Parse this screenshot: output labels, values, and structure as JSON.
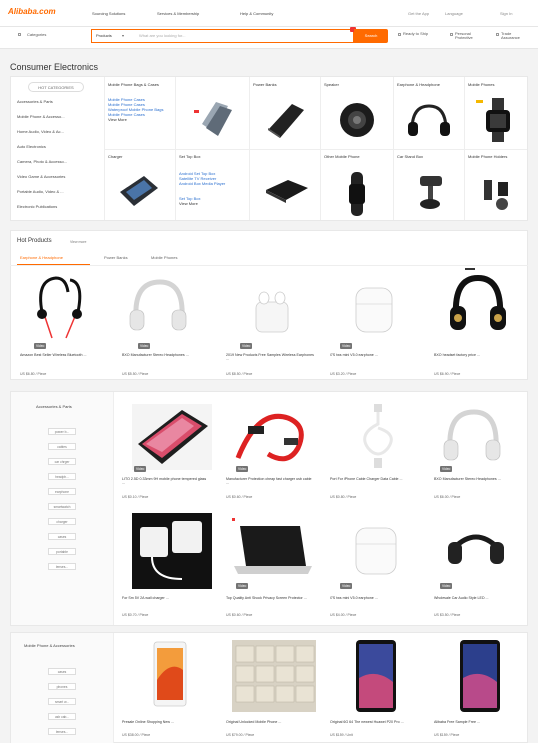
{
  "header": {
    "logo": "Alibaba.com",
    "nav": [
      "Sourcing Solutions",
      "Services & Membership",
      "Help & Community"
    ],
    "right_links": [
      "Get the App",
      "Language",
      "Sign In"
    ]
  },
  "search": {
    "category_label": "Categories",
    "type_label": "Products",
    "placeholder": "What are you looking for...",
    "button": "Search",
    "options": [
      "Ready to Ship",
      "Personal Protective",
      "Trade Assurance",
      "Verified Suppliers"
    ]
  },
  "category": {
    "title": "Consumer Electronics",
    "hot_btn": "HOT CATEGORIES",
    "side": [
      "Accessories & Parts",
      "Mobile Phone & Accesso...",
      "Home Audio, Video & Ac...",
      "Auto Electronics",
      "Camera, Photo & Accesso...",
      "Video Game & Accessories",
      "Portable Audio, Video & ...",
      "Electronic Publications"
    ],
    "cells": [
      {
        "title": "Mobile Phone Bags & Cases",
        "links": [
          "Mobile Phone Cases",
          "Mobile Phone Cases",
          "Waterproof Mobile Phone Bags",
          "Mobile Phone Cases",
          "View More"
        ]
      },
      {
        "title": "Power Banks"
      },
      {
        "title": "Speaker"
      },
      {
        "title": "Earphone & Headphone"
      },
      {
        "title": "Mobile Phones"
      },
      {
        "title": "Charger"
      },
      {
        "title": "Set Top Box",
        "links": [
          "Android Set Top Box",
          "Satellite TV Receiver",
          "Android Box Media Player",
          "Set Top Box",
          "View More"
        ]
      },
      {
        "title": ""
      },
      {
        "title": "Other Mobile Phone"
      },
      {
        "title": "Car Stand Box"
      },
      {
        "title": "Mobile Phone Holders"
      }
    ]
  },
  "hot": {
    "title": "Hot Products",
    "view_more": "View more",
    "tabs": [
      "Earphone & Headphone",
      "Power Banks",
      "Mobile Phones"
    ],
    "products": [
      {
        "title": "Amazon Best Seller Wireless Bluetooth ...",
        "price": "US $6.80 / Piece",
        "tag": "Video"
      },
      {
        "title": "BXO Manufacturer Stereo Headphones ...",
        "price": "US $5.50 / Piece",
        "tag": "Video"
      },
      {
        "title": "2019 New Products Free Samples Wireless Earphones ...",
        "price": "US $8.50 / Piece",
        "tag": "Video"
      },
      {
        "title": "i7S tws mini V5.0 earphone ...",
        "price": "US $3.20 / Piece",
        "tag": "Video"
      },
      {
        "title": "BXO headset factory price ...",
        "price": "US $6.90 / Piece",
        "tag": ""
      }
    ]
  },
  "section1": {
    "title": "Accessories & Parts",
    "chips": [
      "power b...",
      "cables",
      "car chrger",
      "headph...",
      "earphone",
      "smartwatch",
      "charger",
      "cases",
      "portable",
      "lenses..."
    ],
    "products": [
      {
        "title": "LITO 2.5D 0.33mm 9H mobile phone tempered glass ...",
        "price": "US $0.10 / Piece",
        "tag": "Video"
      },
      {
        "title": "Manufacturer Protection cheap fast charger usb cable ...",
        "price": "US $0.60 / Piece",
        "tag": "Video"
      },
      {
        "title": "Port For iPhone Cable Charger Data Cable ...",
        "price": "US $0.80 / Piece",
        "tag": ""
      },
      {
        "title": "BXO Manufacturer Stereo Headphones ...",
        "price": "US $6.00 / Piece",
        "tag": "Video"
      },
      {
        "title": "For Sm 5V 2A wall charger ...",
        "price": "US $0.70 / Piece",
        "tag": "Video"
      },
      {
        "title": "Top Quality Anti Shock Privacy Screen Protector ...",
        "price": "US $0.60 / Piece",
        "tag": "Video"
      },
      {
        "title": "i7S tws mini V5.0 earphone ...",
        "price": "US $4.00 / Piece",
        "tag": "Video"
      },
      {
        "title": "Wholesale Car Audio Style LED ...",
        "price": "US $3.50 / Piece",
        "tag": "Video"
      }
    ]
  },
  "section2": {
    "title": "Mobile Phone & Accessories",
    "chips": [
      "cases",
      "phones",
      "smart w...",
      "usb cab...",
      "lenses..."
    ],
    "products": [
      {
        "title": "Presale Online Shopping New ...",
        "price": "US $38.00 / Piece"
      },
      {
        "title": "Original Unlocked Mobile Phone ...",
        "price": "US $79.00 / Piece"
      },
      {
        "title": "Original 6G 64 The newest Huawei P20 Pro ...",
        "price": "US $159 / Unit"
      },
      {
        "title": "Alibaba Free Sample Free ...",
        "price": "US $159 / Piece"
      }
    ]
  },
  "colors": {
    "accent": "#ff6a00",
    "link": "#2b6fcf"
  }
}
